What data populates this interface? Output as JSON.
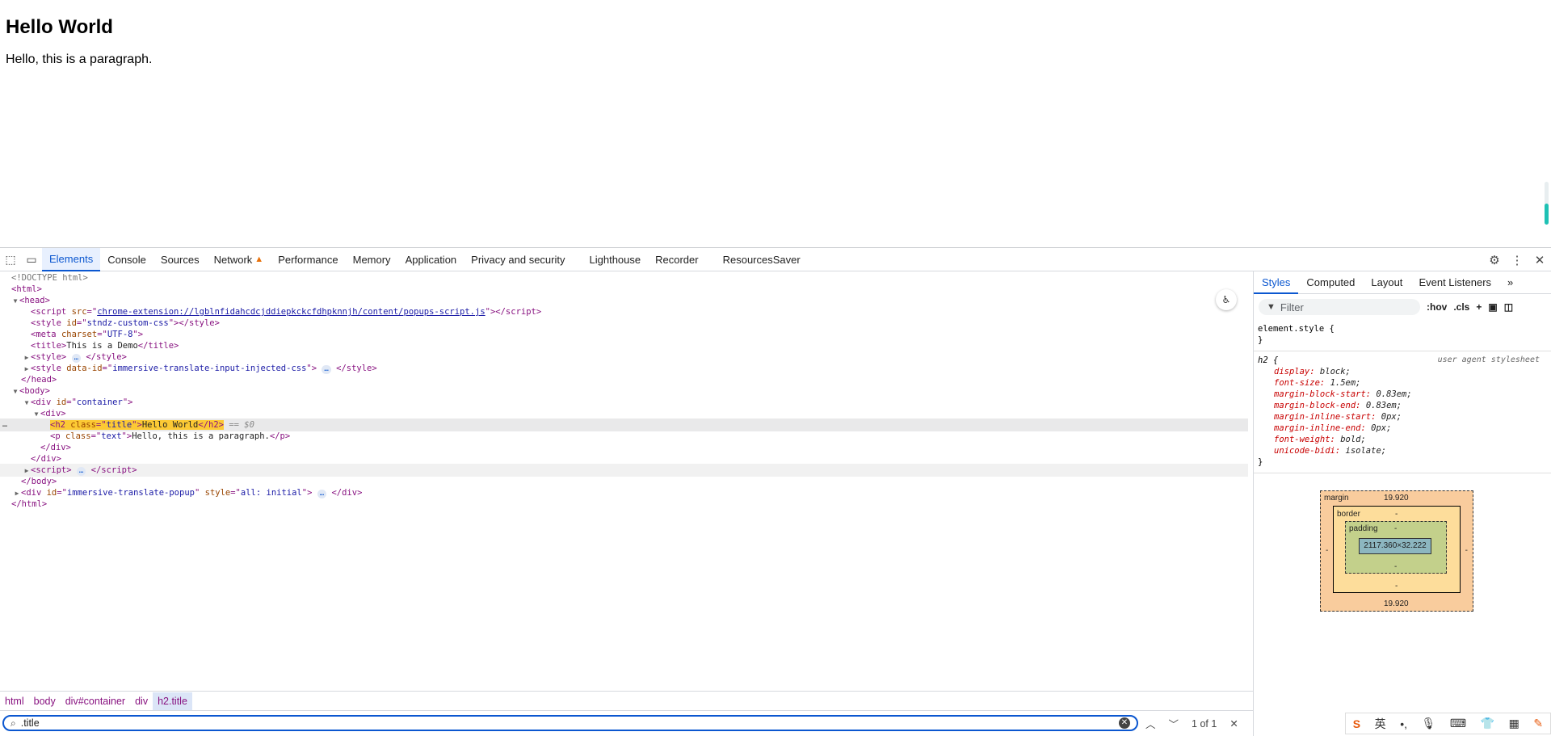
{
  "viewport": {
    "heading": "Hello World",
    "paragraph": "Hello, this is a paragraph."
  },
  "devtools": {
    "tabs": [
      "Elements",
      "Console",
      "Sources",
      "Network",
      "Performance",
      "Memory",
      "Application",
      "Privacy and security",
      "Lighthouse",
      "Recorder",
      "ResourcesSaver"
    ],
    "active_tab": "Elements",
    "network_warning": "▲",
    "dom": {
      "doctype": "<!DOCTYPE html>",
      "script_src": "chrome-extension://lgblnfidahcdcjddiepkckcfdhpknnjh/content/popups-script.js",
      "style_id": "stndz-custom-css",
      "meta_charset": "UTF-8",
      "title_text": "This is a Demo",
      "style_data_id": "immersive-translate-input-injected-css",
      "container_id": "container",
      "h2_class": "title",
      "h2_text": "Hello World",
      "dollar": "== $0",
      "p_class": "text",
      "p_text": "Hello, this is a paragraph.",
      "popup_id": "immersive-translate-popup",
      "popup_style": "all: initial",
      "ellipsis": "…",
      "gutter": "…"
    },
    "breadcrumbs": [
      "html",
      "body",
      "div#container",
      "div",
      "h2.title"
    ],
    "search": {
      "value": ".title",
      "count": "1 of 1"
    },
    "sidebar": {
      "tabs": [
        "Styles",
        "Computed",
        "Layout",
        "Event Listeners"
      ],
      "active_tab": "Styles",
      "filter_placeholder": "Filter",
      "hov": ":hov",
      "cls": ".cls",
      "element_style": "element.style {",
      "close_brace": "}",
      "h2_selector": "h2 {",
      "ua_label": "user agent stylesheet",
      "props": [
        {
          "name": "display",
          "value": "block;"
        },
        {
          "name": "font-size",
          "value": "1.5em;"
        },
        {
          "name": "margin-block-start",
          "value": "0.83em;"
        },
        {
          "name": "margin-block-end",
          "value": "0.83em;"
        },
        {
          "name": "margin-inline-start",
          "value": "0px;"
        },
        {
          "name": "margin-inline-end",
          "value": "0px;"
        },
        {
          "name": "font-weight",
          "value": "bold;"
        },
        {
          "name": "unicode-bidi",
          "value": "isolate;"
        }
      ],
      "box_model": {
        "margin_label": "margin",
        "margin_top": "19.920",
        "margin_bottom": "19.920",
        "margin_left": "-",
        "margin_right": "-",
        "border_label": "border",
        "border_value": "-",
        "padding_label": "padding",
        "padding_value": "-",
        "content": "2117.360×32.222"
      }
    }
  },
  "ime": {
    "lang": "英"
  }
}
